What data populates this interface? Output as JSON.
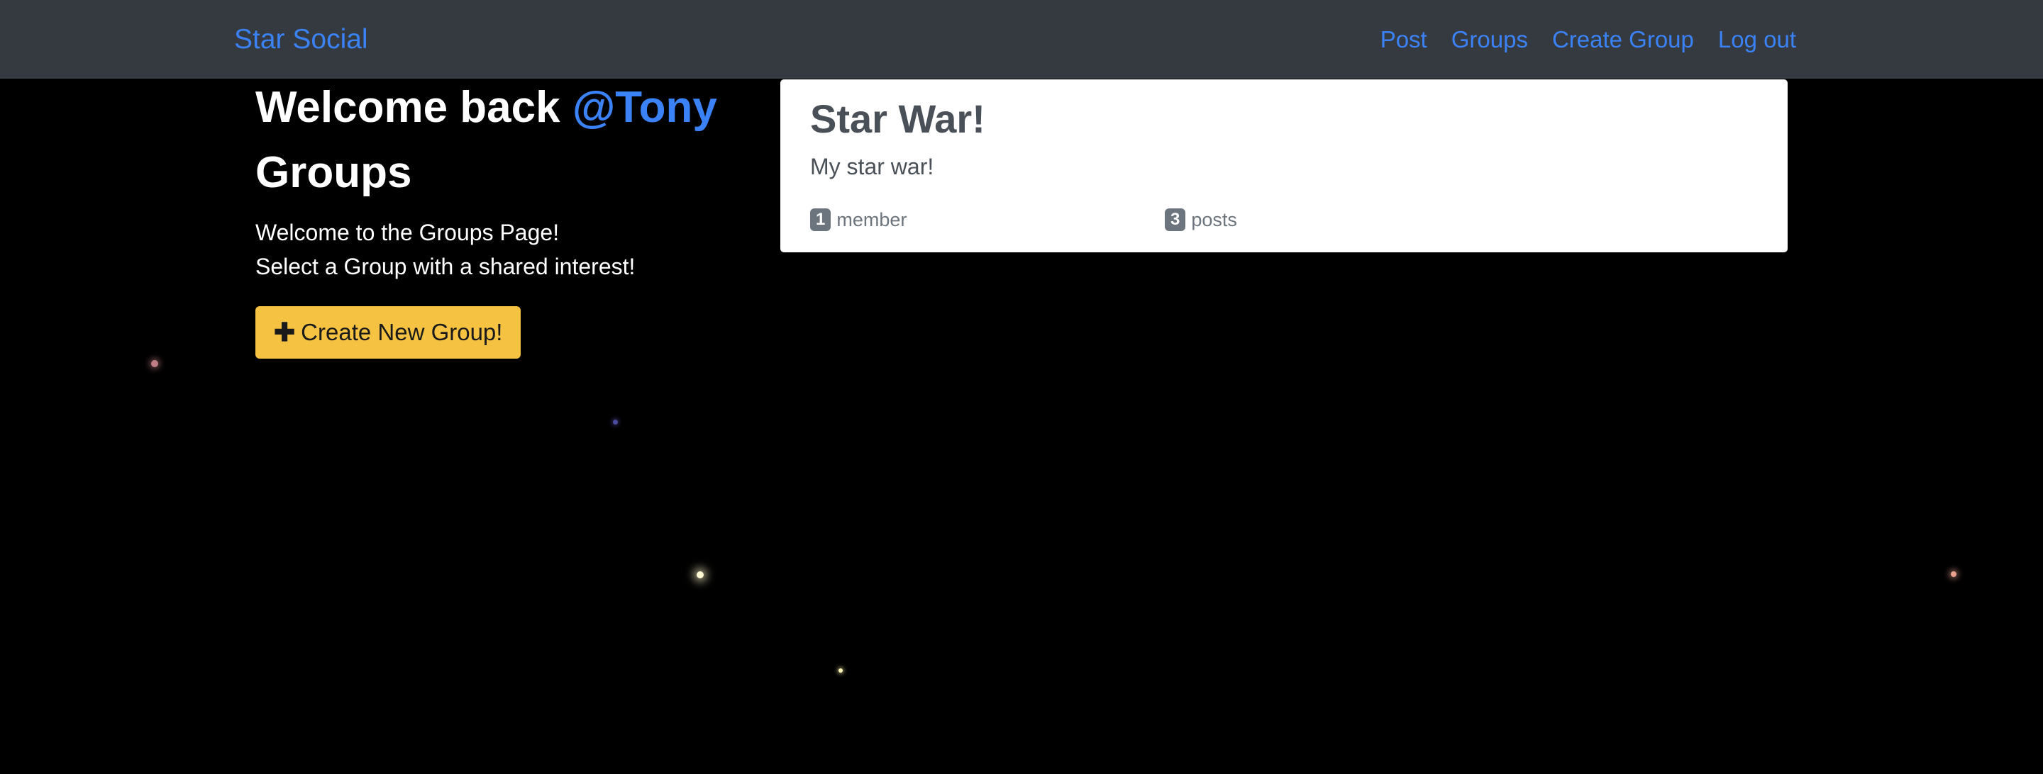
{
  "navbar": {
    "brand": "Star Social",
    "links": [
      "Post",
      "Groups",
      "Create Group",
      "Log out"
    ]
  },
  "sidebar": {
    "welcome_prefix": "Welcome back ",
    "username": "@Tony",
    "heading": "Groups",
    "intro_line1": "Welcome to the Groups Page!",
    "intro_line2": "Select a Group with a shared interest!",
    "create_button": "Create New Group!"
  },
  "groups": [
    {
      "title": "Star War!",
      "description": "My star war!",
      "member_count": "1",
      "member_label": "member",
      "post_count": "3",
      "post_label": "posts"
    }
  ],
  "colors": {
    "accent": "#3b82f6",
    "navbar_bg": "#343a40",
    "button_bg": "#f5c242",
    "badge_bg": "#6c757d"
  }
}
